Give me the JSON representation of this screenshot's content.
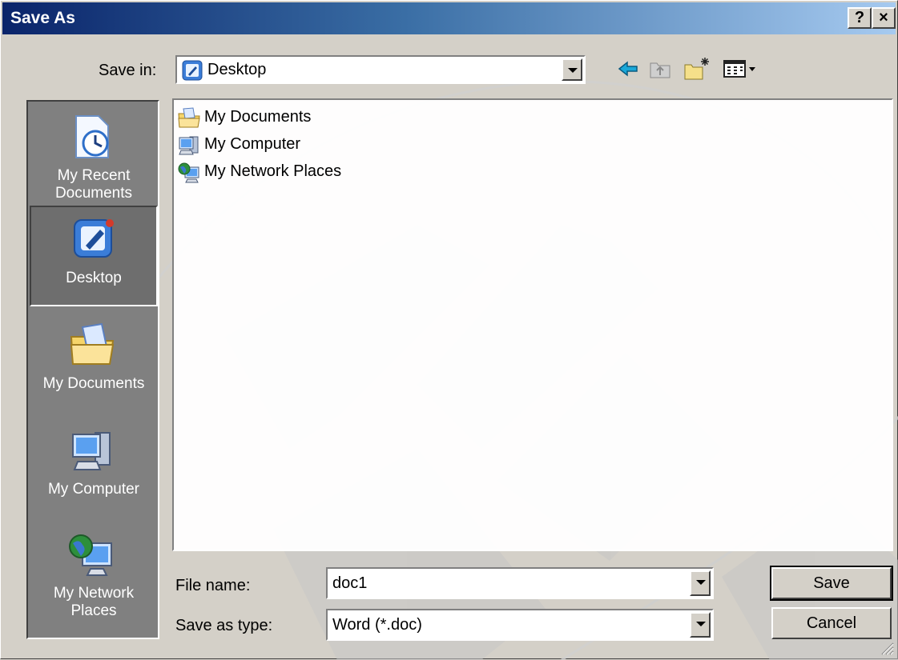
{
  "window": {
    "title": "Save As",
    "help_label": "?",
    "close_label": "×"
  },
  "save_in": {
    "label": "Save in:",
    "value": "Desktop"
  },
  "places": [
    {
      "label": "My Recent Documents",
      "icon": "recent-documents-icon"
    },
    {
      "label": "Desktop",
      "icon": "desktop-icon",
      "selected": true
    },
    {
      "label": "My Documents",
      "icon": "my-documents-icon"
    },
    {
      "label": "My Computer",
      "icon": "my-computer-icon"
    },
    {
      "label": "My Network Places",
      "icon": "network-places-icon"
    }
  ],
  "files": [
    {
      "name": "My Documents",
      "icon": "my-documents-icon"
    },
    {
      "name": "My Computer",
      "icon": "my-computer-icon"
    },
    {
      "name": "My Network Places",
      "icon": "network-places-icon"
    }
  ],
  "file_name": {
    "label": "File name:",
    "value": "doc1"
  },
  "save_as_type": {
    "label": "Save as type:",
    "value": "Word (*.doc)"
  },
  "buttons": {
    "save": "Save",
    "cancel": "Cancel"
  },
  "toolbar": [
    "back-icon",
    "up-folder-icon",
    "new-folder-icon",
    "views-menu-icon"
  ]
}
